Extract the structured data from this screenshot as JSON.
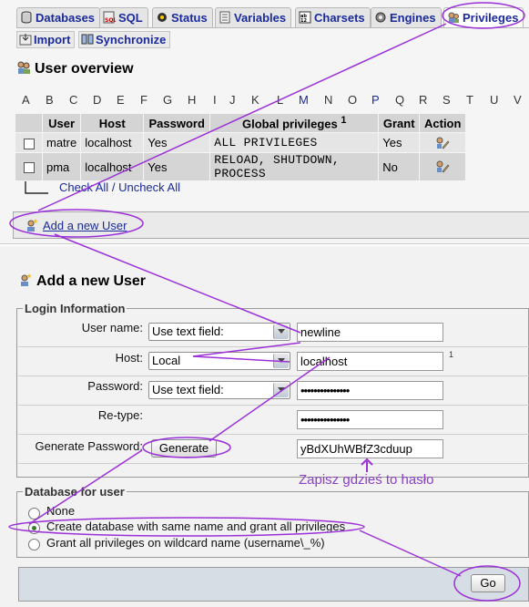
{
  "tabs": [
    {
      "label": "Databases",
      "icon": "databases-icon"
    },
    {
      "label": "SQL",
      "icon": "sql-icon"
    },
    {
      "label": "Status",
      "icon": "status-icon"
    },
    {
      "label": "Variables",
      "icon": "variables-icon"
    },
    {
      "label": "Charsets",
      "icon": "charsets-icon"
    },
    {
      "label": "Engines",
      "icon": "engines-icon"
    },
    {
      "label": "Privileges",
      "icon": "privileges-icon",
      "active": true
    }
  ],
  "subtabs": [
    {
      "label": "Import",
      "icon": "import-icon"
    },
    {
      "label": "Synchronize",
      "icon": "synchronize-icon"
    }
  ],
  "overview": {
    "title": "User overview",
    "letters": [
      "A",
      "B",
      "C",
      "D",
      "E",
      "F",
      "G",
      "H",
      "I",
      "J",
      "K",
      "L",
      "M",
      "N",
      "O",
      "P",
      "Q",
      "R",
      "S",
      "T",
      "U",
      "V"
    ],
    "linked_letters": [
      "M",
      "P"
    ],
    "columns": [
      "",
      "User",
      "Host",
      "Password",
      "Global privileges",
      "Grant",
      "Action"
    ],
    "global_priv_sup": "1",
    "rows": [
      {
        "user": "matre",
        "host": "localhost",
        "password": "Yes",
        "privileges": "ALL PRIVILEGES",
        "grant": "Yes"
      },
      {
        "user": "pma",
        "host": "localhost",
        "password": "Yes",
        "privileges": "RELOAD, SHUTDOWN, PROCESS",
        "grant": "No"
      }
    ],
    "check_all": "Check All",
    "separator": "/",
    "uncheck_all": "Uncheck All",
    "add_user_link": "Add a new User"
  },
  "add_user": {
    "title": "Add a new User",
    "login_legend": "Login Information",
    "username_label": "User name:",
    "username_select": "Use text field:",
    "username_value": "newline",
    "host_label": "Host:",
    "host_select": "Local",
    "host_value": "localhost",
    "host_sup": "1",
    "password_label": "Password:",
    "password_select": "Use text field:",
    "password_value": "•••••••••••••••",
    "retype_label": "Re-type:",
    "retype_value": "•••••••••••••••",
    "generate_label": "Generate Password:",
    "generate_button": "Generate",
    "generated_value": "yBdXUhWBfZ3cduup",
    "note": "Zapisz gdzieś to hasło",
    "db_legend": "Database for user",
    "radio_none": "None",
    "radio_create": "Create database with same name and grant all privileges",
    "radio_wildcard": "Grant all privileges on wildcard name (username\\_%)",
    "selected_radio": "create",
    "go_button": "Go"
  },
  "colors": {
    "link": "#1a2a9a",
    "annotation": "#9b30d9"
  }
}
